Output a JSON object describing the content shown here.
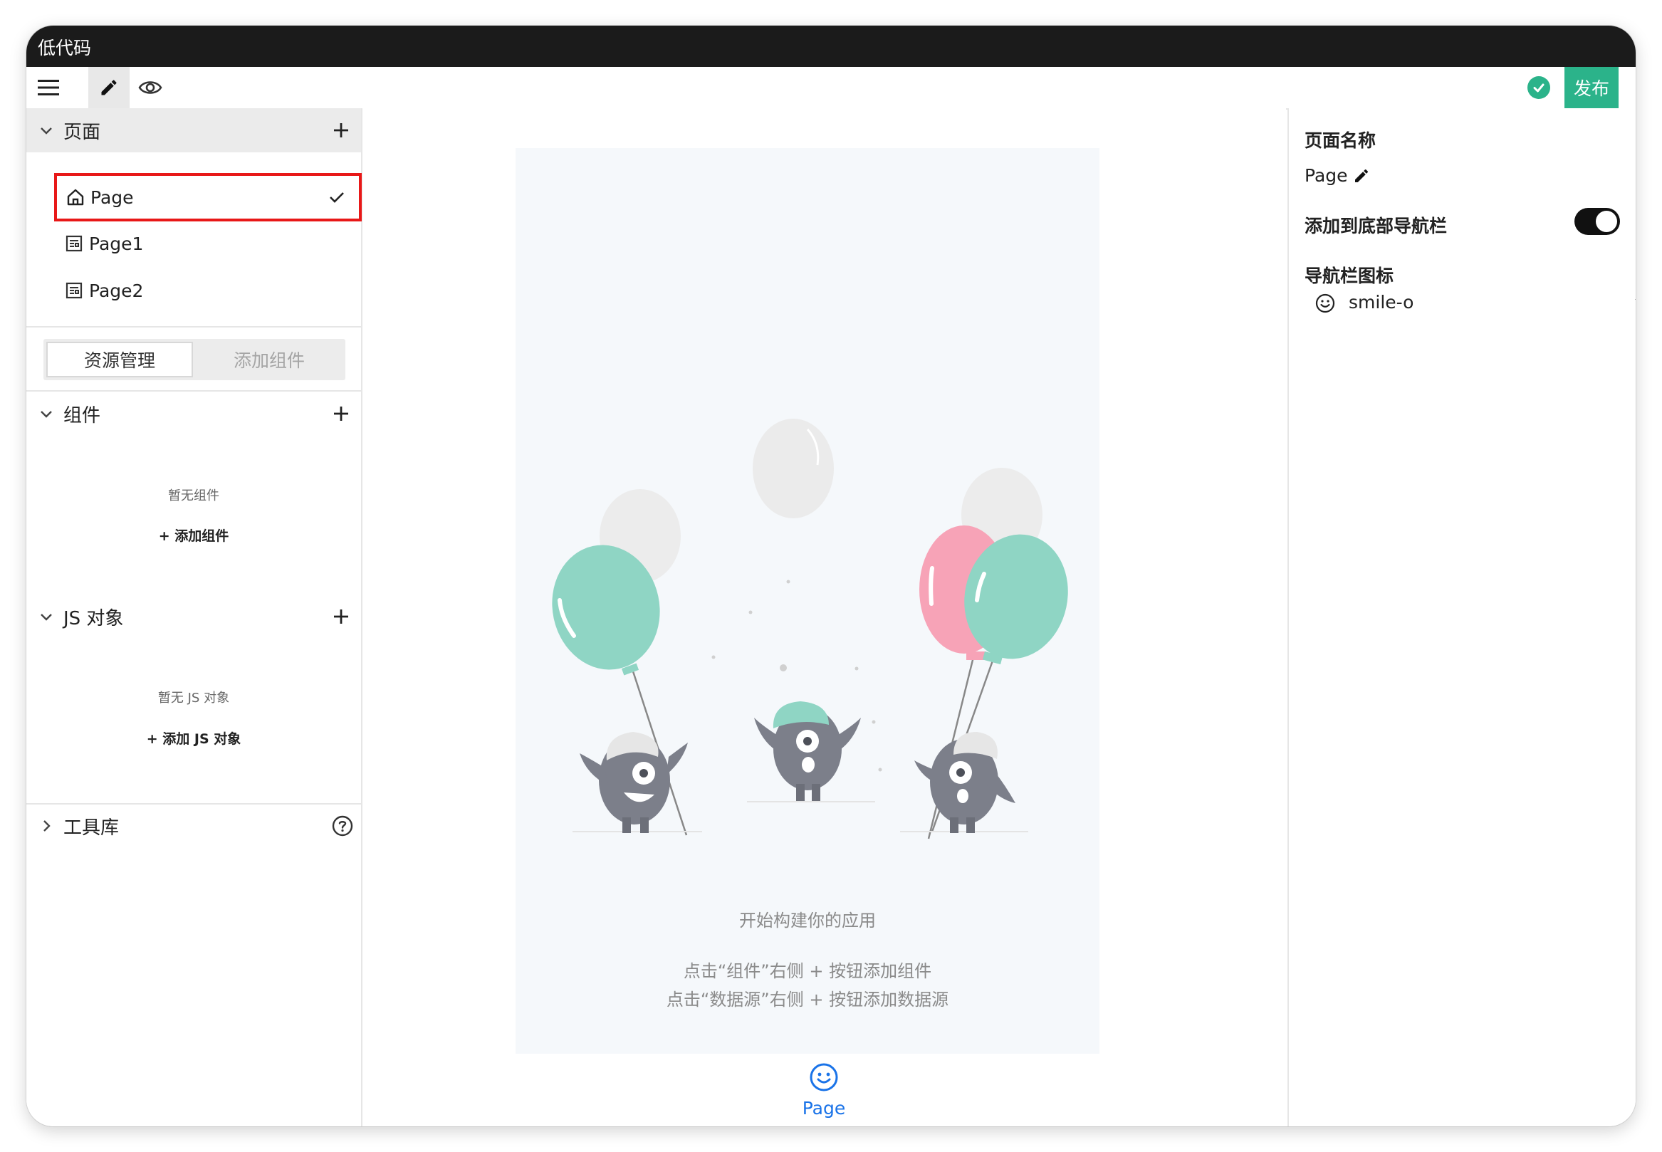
{
  "app": {
    "title": "低代码"
  },
  "toolbar": {
    "menu_icon": "hamburger-menu-icon",
    "edit_icon": "pencil-icon",
    "preview_icon": "eye-icon",
    "status_icon": "check-circle-icon",
    "publish_label": "发布",
    "accent_color": "#2bb38a"
  },
  "left_panel": {
    "pages": {
      "title": "页面",
      "items": [
        {
          "label": "Page",
          "icon": "home-icon",
          "selected": true
        },
        {
          "label": "Page1",
          "icon": "page-icon",
          "selected": false
        },
        {
          "label": "Page2",
          "icon": "page-icon",
          "selected": false
        }
      ]
    },
    "tabs": [
      {
        "label": "资源管理",
        "active": true
      },
      {
        "label": "添加组件",
        "active": false
      }
    ],
    "components": {
      "title": "组件",
      "empty_text": "暂无组件",
      "add_label": "+ 添加组件"
    },
    "js_objects": {
      "title": "JS 对象",
      "empty_text": "暂无 JS 对象",
      "add_label": "+ 添加 JS 对象"
    },
    "toolkit": {
      "title": "工具库"
    }
  },
  "canvas": {
    "empty_title": "开始构建你的应用",
    "hint_line1": "点击“组件”右侧 + 按钮添加组件",
    "hint_line2": "点击“数据源”右侧 + 按钮添加数据源",
    "tabbar_label": "Page",
    "tabbar_icon": "smile-icon",
    "tabbar_color": "#1a73e8"
  },
  "right_panel": {
    "page_name_label": "页面名称",
    "page_name_value": "Page",
    "bottom_nav_label": "添加到底部导航栏",
    "bottom_nav_enabled": true,
    "nav_icon_label": "导航栏图标",
    "nav_icon_value": "smile-o"
  }
}
